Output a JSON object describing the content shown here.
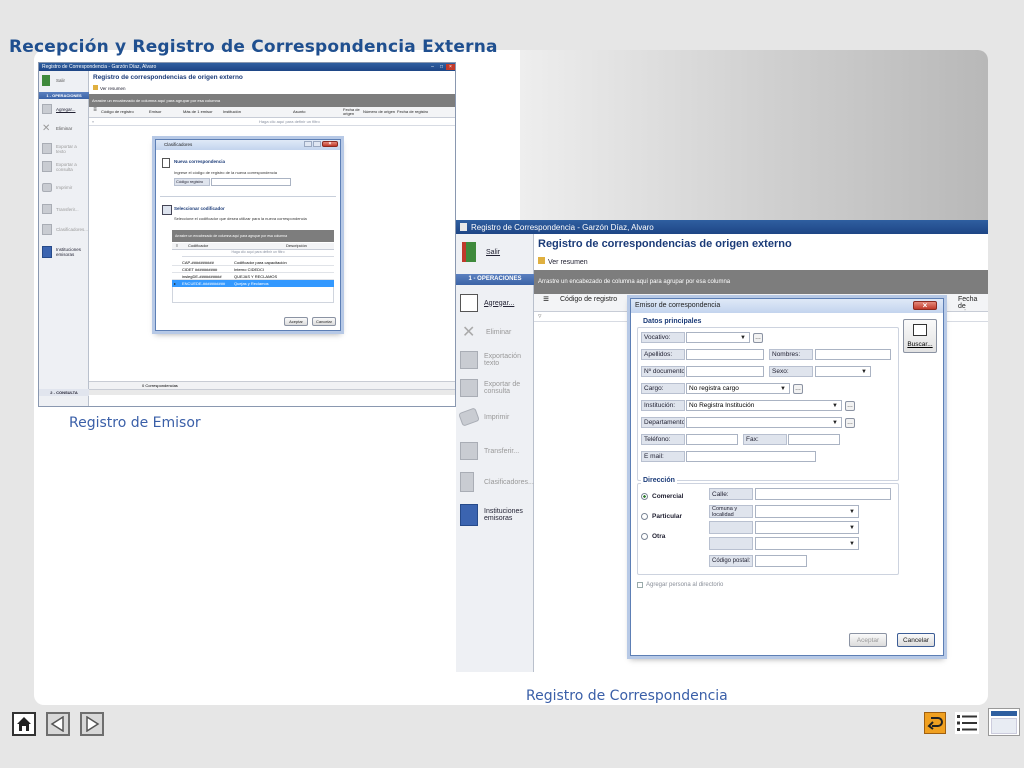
{
  "slide": {
    "title": "Recepción y Registro de Correspondencia Externa",
    "caption_left": "Registro de Emisor",
    "caption_right": "Registro de Correspondencia"
  },
  "colors": {
    "title_blue": "#1f4f8f",
    "window_title": "#2f5fa0",
    "accent_blue": "#3b64b0",
    "group_bar": "#7d7d7d"
  },
  "app_small": {
    "window_title": "Registro de Correspondencia - Garzón Díaz, Alvaro",
    "controls": [
      "–",
      "□",
      "×"
    ],
    "sidebar": {
      "exit": "Salir",
      "section": "1 - OPERACIONES",
      "items": [
        "Agregar...",
        "Eliminar",
        "Exportar a texto",
        "Exportar a consulta",
        "Imprimir",
        "Transferir...",
        "Clasificadores...",
        "Instituciones emisoras"
      ],
      "bottom_section": "2 - CONSULTA"
    },
    "header": "Registro de correspondencias de origen externo",
    "toolbar_link": "Ver resumen",
    "group_hint": "Arrastre un encabezado de columna aquí para agrupar por esa columna",
    "columns": [
      "Código de registro",
      "Emisor",
      "Más de 1 emisor",
      "Institución",
      "Asunto",
      "Fecha de origen",
      "Número de origen",
      "Fecha de registro"
    ],
    "filter_hint": "Haga clic aquí para definir un filtro",
    "status": "0 Correspondencias",
    "dialog": {
      "title": "Clasificadores",
      "section1_title": "Nueva correspondencia",
      "section1_text": "Ingrese el código de registro de la nueva correspondencia",
      "code_label": "Código registro",
      "section2_title": "Seleccionar codificador",
      "section2_text": "Seleccione el codificador que desea utilizar para la nueva correspondencia",
      "grid_hint": "Arrastre un encabezado de columna aquí para agrupar por esa columna",
      "grid_cols": [
        "Codificador",
        "Descripción"
      ],
      "grid_filter": "Haga clic aquí para definir un filtro",
      "rows": [
        {
          "code": "CAP-##########",
          "desc": "Codificador para capacitación"
        },
        {
          "code": "CIDET ##########",
          "desc": "Interno CIDEDCI"
        },
        {
          "code": "inslegDE-##########",
          "desc": "QUEJAS Y RECLAMOS"
        },
        {
          "code": "ENCUEDE-##########",
          "desc": "Quejas y Reclamos"
        }
      ],
      "accept": "Aceptar",
      "cancel": "Cancelar"
    }
  },
  "app_large": {
    "window_title": "Registro de Correspondencia - Garzón Díaz, Alvaro",
    "sidebar": {
      "exit": "Salir",
      "section": "1 - OPERACIONES",
      "items": [
        "Agregar...",
        "Eliminar",
        "Exportación texto",
        "Exportar de consulta",
        "Imprimir",
        "Transferir...",
        "Clasificadores...",
        "Instituciones emisoras"
      ]
    },
    "header": "Registro de correspondencias de origen externo",
    "toolbar_link": "Ver resumen",
    "group_hint": "Arrastre un encabezado de columna aquí para agrupar por esa columna",
    "col_first": "Código de registro",
    "col_last": "Fecha de origen",
    "dialog": {
      "title": "Emisor de correspondencia",
      "close": "×",
      "section_main": "Datos principales",
      "labels": {
        "vocativo": "Vocativo:",
        "apellidos": "Apellidos:",
        "nombres": "Nombres:",
        "documento": "Nº documento:",
        "sexo": "Sexo:",
        "cargo": "Cargo:",
        "institucion": "Institución:",
        "departamento": "Departamento:",
        "telefono": "Teléfono:",
        "fax": "Fax:",
        "email": "E mail:"
      },
      "values": {
        "cargo": "No registra cargo",
        "institucion": "No Registra Institución"
      },
      "search_button": "Buscar...",
      "section_address": "Dirección",
      "radios": [
        "Comercial",
        "Particular",
        "Otra"
      ],
      "addr_labels": {
        "calle": "Calle:",
        "comuna": "Comuna y localidad",
        "codigo_postal": "Código postal:"
      },
      "checkbox": "Agregar persona al directorio",
      "accept": "Aceptar",
      "cancel": "Cancelar"
    }
  }
}
